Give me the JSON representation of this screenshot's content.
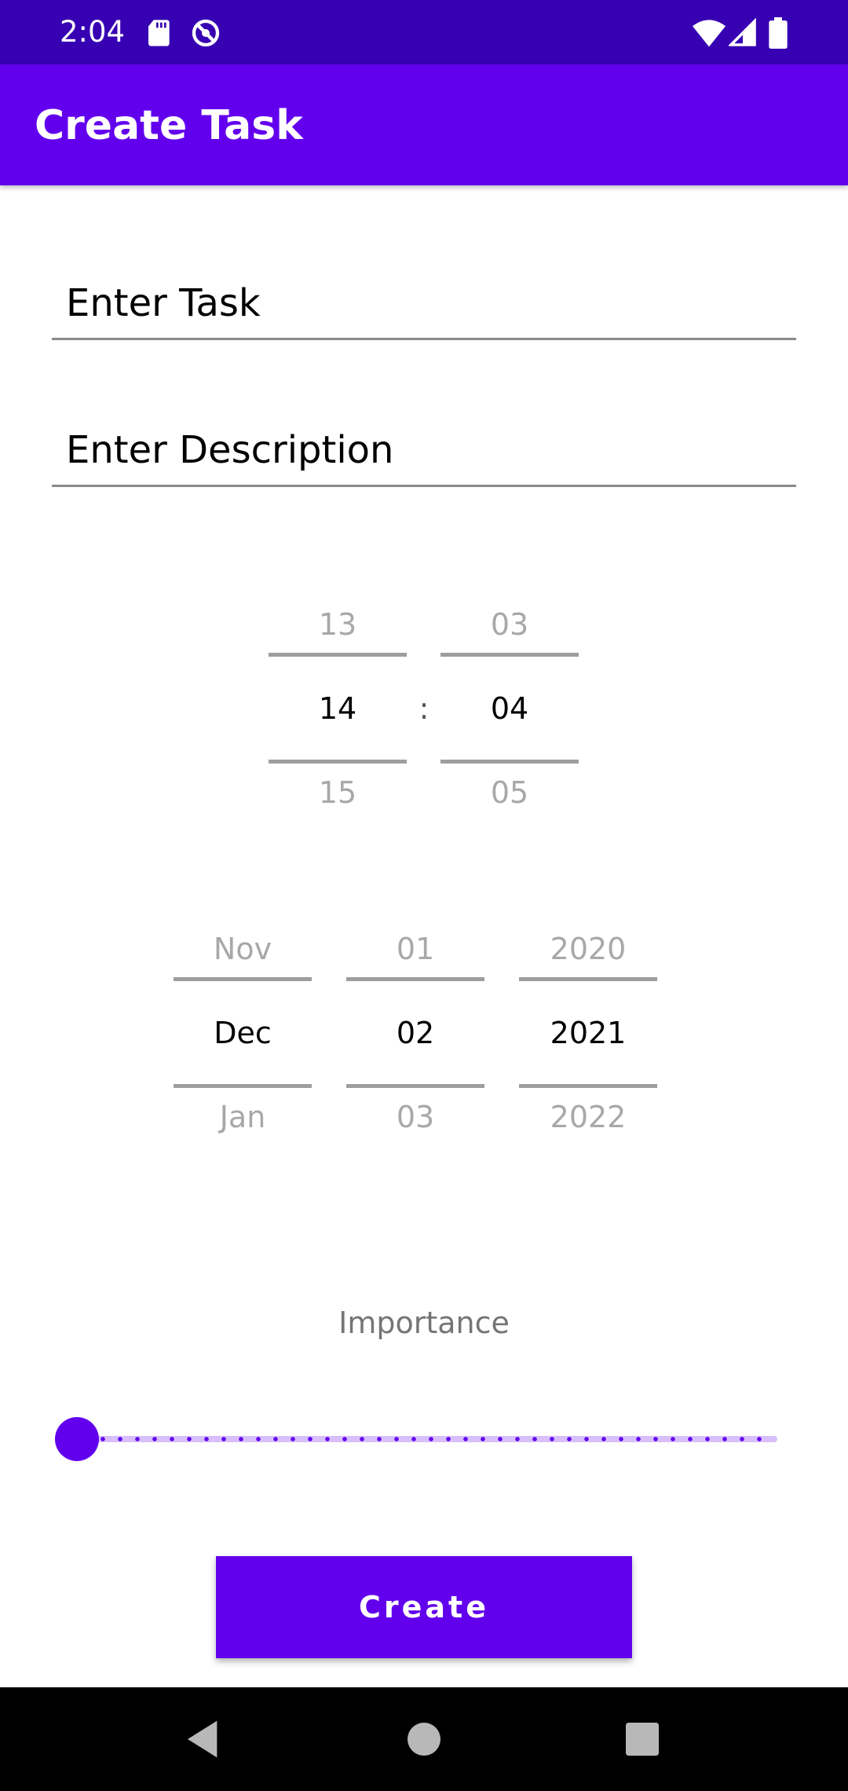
{
  "status_bar": {
    "time": "2:04",
    "icons": [
      "sd-card-icon",
      "do-not-disturb-icon",
      "wifi-icon",
      "signal-icon",
      "battery-icon"
    ]
  },
  "app_bar": {
    "title": "Create Task"
  },
  "form": {
    "task_field": {
      "placeholder": "Enter Task",
      "value": ""
    },
    "description_field": {
      "placeholder": "Enter Description",
      "value": ""
    }
  },
  "time_picker": {
    "separator": ":",
    "hour": {
      "prev": "13",
      "current": "14",
      "next": "15"
    },
    "minute": {
      "prev": "03",
      "current": "04",
      "next": "05"
    }
  },
  "date_picker": {
    "month": {
      "prev": "Nov",
      "current": "Dec",
      "next": "Jan"
    },
    "day": {
      "prev": "01",
      "current": "02",
      "next": "03"
    },
    "year": {
      "prev": "2020",
      "current": "2021",
      "next": "2022"
    }
  },
  "importance": {
    "label": "Importance",
    "value": 0
  },
  "create_button": {
    "label": "Create"
  },
  "nav_bar": {
    "buttons": [
      "back-icon",
      "home-icon",
      "recents-icon"
    ]
  },
  "colors": {
    "status_bar": "#3700b3",
    "primary": "#6200ee",
    "nav_bar": "#000000"
  }
}
